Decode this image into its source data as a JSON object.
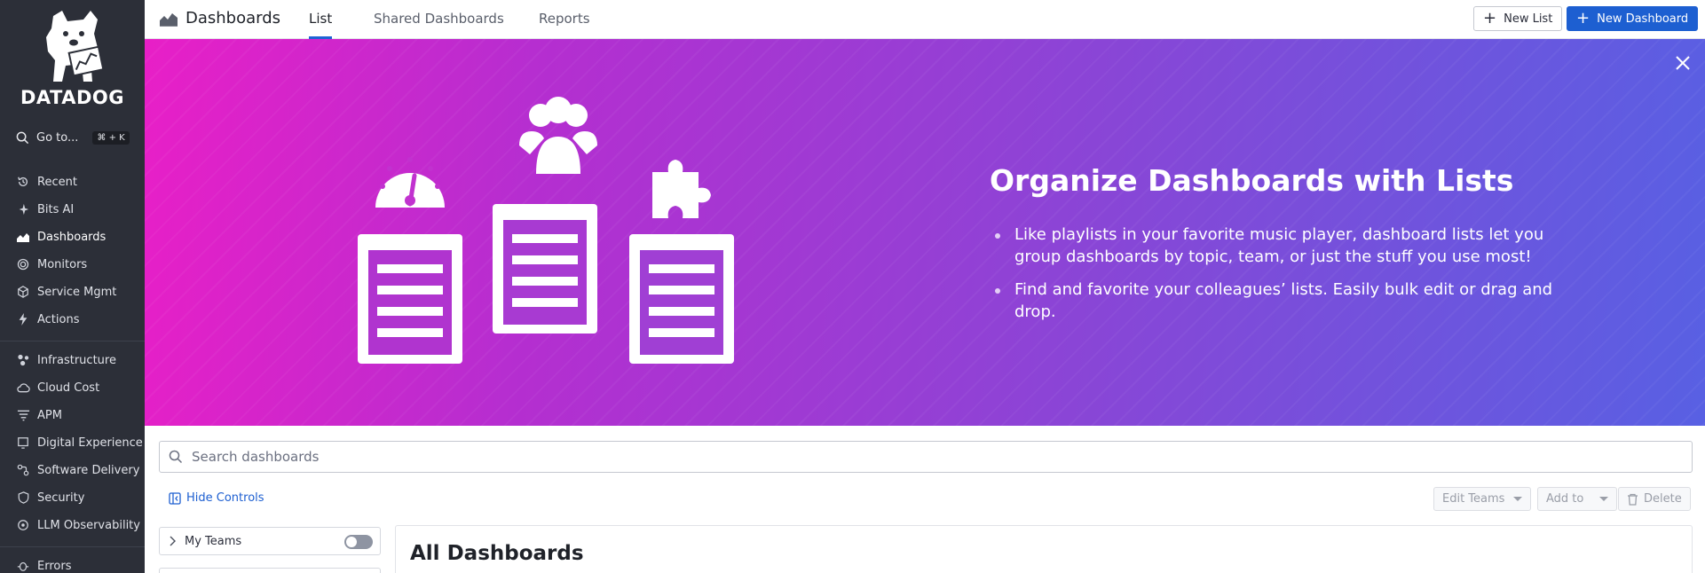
{
  "sidebar": {
    "logo_text": "DATADOG",
    "goto": {
      "label": "Go to...",
      "shortcut": "⌘ + K"
    },
    "items": [
      {
        "label": "Recent",
        "icon": "history-icon"
      },
      {
        "label": "Bits AI",
        "icon": "sparkle-icon"
      },
      {
        "label": "Dashboards",
        "icon": "dashboard-icon",
        "active": true
      },
      {
        "label": "Monitors",
        "icon": "monitor-icon"
      },
      {
        "label": "Service Mgmt",
        "icon": "cube-icon"
      },
      {
        "label": "Actions",
        "icon": "bolt-icon"
      },
      {
        "label": "Infrastructure",
        "icon": "infrastructure-icon"
      },
      {
        "label": "Cloud Cost",
        "icon": "cloud-dollar-icon"
      },
      {
        "label": "APM",
        "icon": "apm-icon"
      },
      {
        "label": "Digital Experience",
        "icon": "digital-experience-icon"
      },
      {
        "label": "Software Delivery",
        "icon": "delivery-icon"
      },
      {
        "label": "Security",
        "icon": "shield-icon"
      },
      {
        "label": "LLM Observability",
        "icon": "llm-icon"
      },
      {
        "label": "Errors",
        "icon": "bug-icon"
      }
    ]
  },
  "header": {
    "title": "Dashboards",
    "tabs": [
      {
        "label": "List",
        "active": true
      },
      {
        "label": "Shared Dashboards"
      },
      {
        "label": "Reports"
      }
    ],
    "new_list_label": "New List",
    "new_dashboard_label": "New Dashboard"
  },
  "banner": {
    "title": "Organize Dashboards with Lists",
    "bullets": [
      "Like playlists in your favorite music player, dashboard lists let you group dashboards by topic, team, or just the stuff you use most!",
      "Find and favorite your colleagues’ lists. Easily bulk edit or drag and drop."
    ]
  },
  "search": {
    "placeholder": "Search dashboards",
    "value": ""
  },
  "controls": {
    "hide_controls_label": "Hide Controls",
    "edit_teams_label": "Edit Teams",
    "add_to_label": "Add to",
    "delete_label": "Delete"
  },
  "filters": {
    "my_teams_label": "My Teams",
    "my_teams_enabled": false
  },
  "main": {
    "section_title": "All Dashboards"
  },
  "colors": {
    "accent": "#1d5fd1",
    "sidebar_bg": "#2c2f38",
    "banner_start": "#e81fc7",
    "banner_end": "#5860e3"
  }
}
